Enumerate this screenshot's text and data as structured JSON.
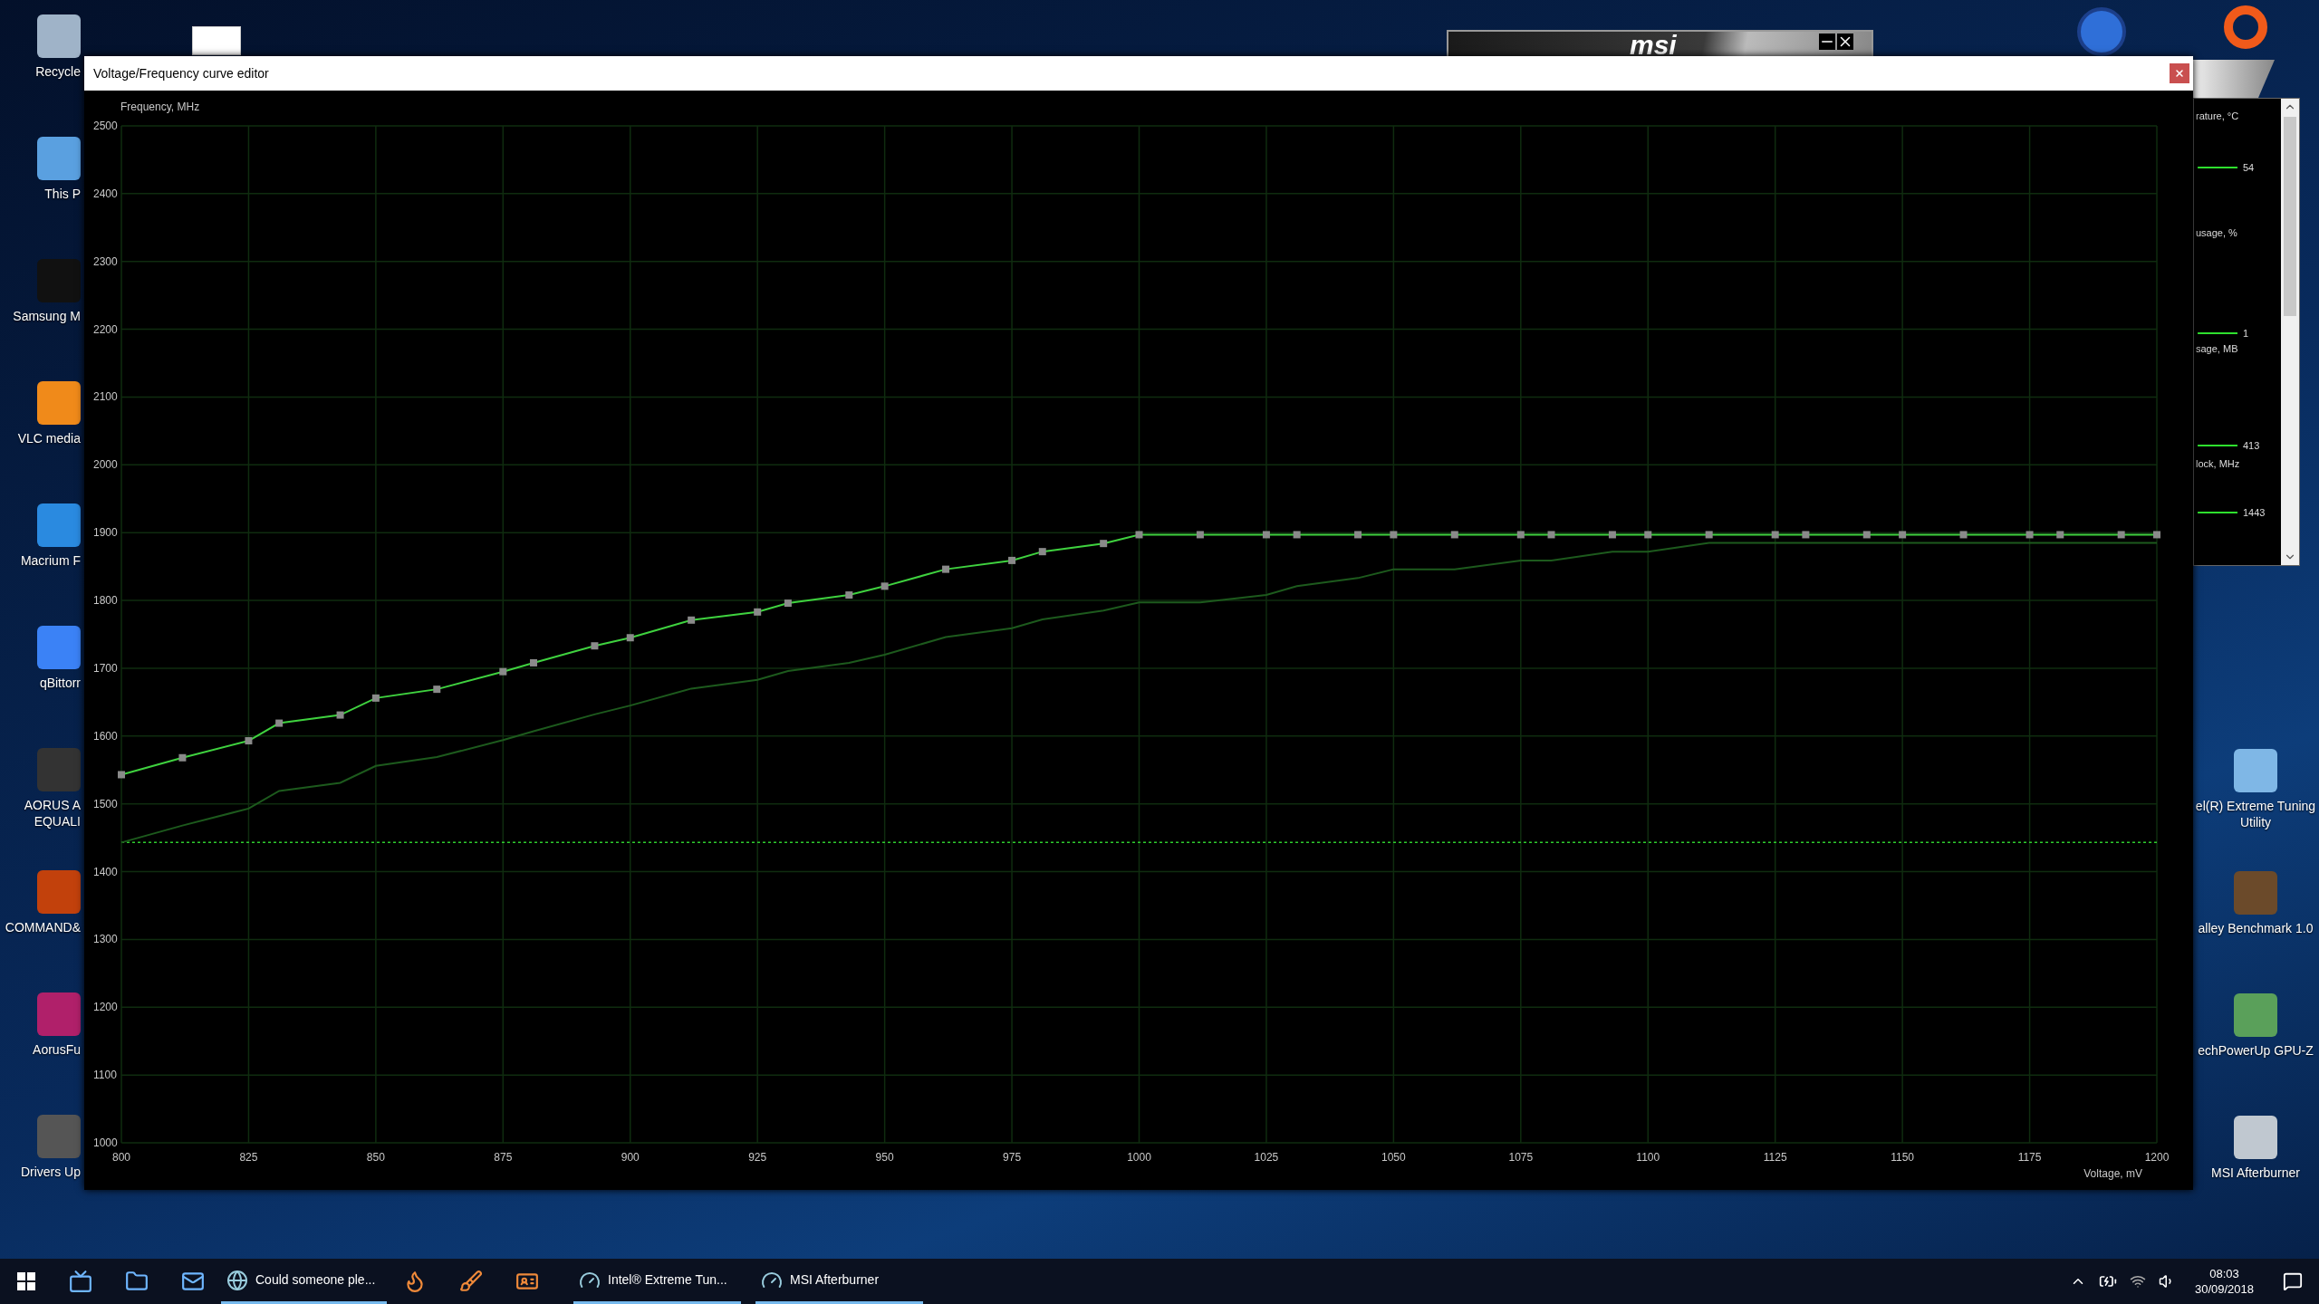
{
  "desktop": {
    "left_icons": [
      {
        "label": [
          "Recycle"
        ]
      },
      {
        "label": [
          "This P"
        ]
      },
      {
        "label": [
          "Samsung M"
        ]
      },
      {
        "label": [
          "VLC media"
        ]
      },
      {
        "label": [
          "Macrium F"
        ]
      },
      {
        "label": [
          "qBittorr"
        ]
      },
      {
        "label": [
          "AORUS A",
          "EQUALI"
        ]
      },
      {
        "label": [
          "COMMAND&"
        ]
      },
      {
        "label": [
          "AorusFu"
        ]
      },
      {
        "label": [
          "Drivers Up"
        ]
      }
    ],
    "right_icons": [
      {
        "label": [
          "el(R) Extreme Tuning",
          "Utility"
        ]
      },
      {
        "label": [
          "alley Benchmark 1.0"
        ]
      },
      {
        "label": [
          "echPowerUp GPU-Z"
        ]
      },
      {
        "label": [
          "MSI Afterburner"
        ]
      }
    ]
  },
  "msi_window": {
    "logo": "msi"
  },
  "monitor": {
    "labels": [
      "rature, °C",
      "usage, %",
      "sage, MB",
      "lock, MHz"
    ],
    "values": [
      "54",
      "1",
      "413",
      "1443"
    ]
  },
  "editor": {
    "title": "Voltage/Frequency curve editor",
    "chart_data": {
      "type": "line",
      "xlabel": "Voltage, mV",
      "ylabel": "Frequency, MHz",
      "x": [
        800,
        812,
        825,
        831,
        843,
        850,
        862,
        875,
        881,
        893,
        900,
        912,
        925,
        931,
        943,
        950,
        962,
        975,
        981,
        993,
        1000,
        1012,
        1025,
        1031,
        1043,
        1050,
        1062,
        1075,
        1081,
        1093,
        1100,
        1112,
        1125,
        1131,
        1143,
        1150,
        1162,
        1175,
        1181,
        1193,
        1200
      ],
      "series": [
        {
          "color": "#3fd23f",
          "marker": "square",
          "values": [
            1543,
            1568,
            1593,
            1619,
            1631,
            1656,
            1669,
            1695,
            1708,
            1733,
            1745,
            1771,
            1783,
            1796,
            1808,
            1821,
            1846,
            1859,
            1872,
            1884,
            1897,
            1897,
            1897,
            1897,
            1897,
            1897,
            1897,
            1897,
            1897,
            1897,
            1897,
            1897,
            1897,
            1897,
            1897,
            1897,
            1897,
            1897,
            1897,
            1897,
            1897
          ]
        },
        {
          "color": "#1d5a1d",
          "values": [
            1443,
            1468,
            1493,
            1519,
            1531,
            1556,
            1569,
            1594,
            1607,
            1632,
            1645,
            1670,
            1683,
            1696,
            1708,
            1720,
            1746,
            1759,
            1772,
            1785,
            1797,
            1797,
            1808,
            1821,
            1833,
            1846,
            1846,
            1859,
            1859,
            1872,
            1872,
            1885,
            1885,
            1885,
            1885,
            1885,
            1885,
            1885,
            1885,
            1885,
            1885
          ]
        }
      ],
      "xlim": [
        800,
        1200
      ],
      "ylim": [
        1000,
        2500
      ],
      "xticks": [
        800,
        825,
        850,
        875,
        900,
        925,
        950,
        975,
        1000,
        1025,
        1050,
        1075,
        1100,
        1125,
        1150,
        1175,
        1200
      ],
      "yticks": [
        1000,
        1100,
        1200,
        1300,
        1400,
        1500,
        1600,
        1700,
        1800,
        1900,
        2000,
        2100,
        2200,
        2300,
        2400,
        2500
      ],
      "grid": true,
      "ref_lines": [
        {
          "axis": "y",
          "value": 1443,
          "color": "#2ecc2e"
        }
      ]
    }
  },
  "taskbar": {
    "items": [
      {
        "label": "Could someone ple...",
        "running": true
      },
      {
        "label": "Intel® Extreme Tun...",
        "running": true
      },
      {
        "label": "MSI Afterburner",
        "running": true
      }
    ],
    "clock": {
      "time": "08:03",
      "date": "30/09/2018"
    }
  }
}
